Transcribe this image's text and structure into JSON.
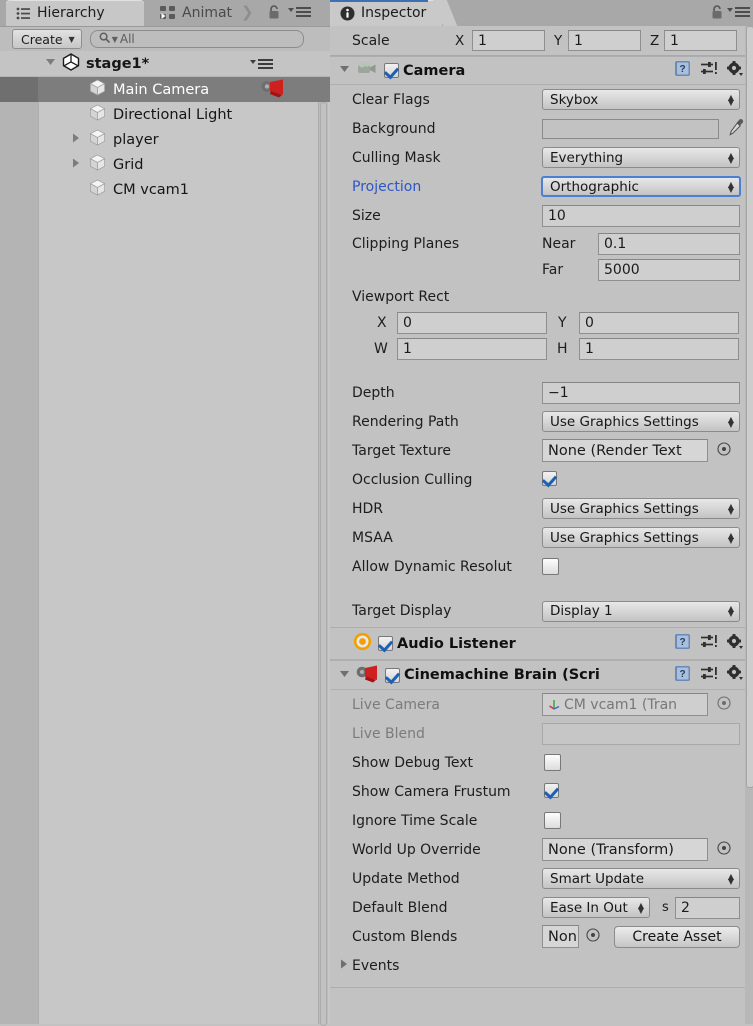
{
  "hierarchy": {
    "tabs": [
      {
        "label": "Hierarchy",
        "icon": "hierarchy-list-icon",
        "active": true
      },
      {
        "label": "Animat",
        "icon": "animator-nodes-icon",
        "active": false
      }
    ],
    "toolbar": {
      "create_label": "Create",
      "create_caret": "▼",
      "search_value": "",
      "search_placeholder": "All",
      "search_icon": "magnifier-icon"
    },
    "scene": {
      "name": "stage1*",
      "expanded": true,
      "icon": "unity-scene-icon"
    },
    "items": [
      {
        "label": "Main Camera",
        "icon": "gameobject-cube-icon",
        "selected": true,
        "expandable": false,
        "badge": "cinemachine-camera-icon"
      },
      {
        "label": "Directional Light",
        "icon": "gameobject-cube-icon",
        "selected": false,
        "expandable": false
      },
      {
        "label": "player",
        "icon": "gameobject-cube-icon",
        "selected": false,
        "expandable": true
      },
      {
        "label": "Grid",
        "icon": "gameobject-cube-icon",
        "selected": false,
        "expandable": true
      },
      {
        "label": "CM vcam1",
        "icon": "gameobject-cube-icon",
        "selected": false,
        "expandable": false
      }
    ]
  },
  "inspector": {
    "tab_label": "Inspector",
    "tab_icon": "info-circle-icon",
    "accent_color": "#3c6fb4",
    "transform_scale": {
      "label": "Scale",
      "axes": [
        {
          "axis": "X",
          "value": "1"
        },
        {
          "axis": "Y",
          "value": "1"
        },
        {
          "axis": "Z",
          "value": "1"
        }
      ]
    },
    "components": [
      {
        "name": "Camera",
        "icon": "camera-icon",
        "enabled": true,
        "expanded": true,
        "header_icons": [
          "help-book-icon",
          "preset-slider-icon",
          "gear-icon"
        ],
        "properties": [
          {
            "type": "popup",
            "label": "Clear Flags",
            "value": "Skybox"
          },
          {
            "type": "color",
            "label": "Background",
            "value": "#3b4a72",
            "eyedropper": "eyedropper-icon"
          },
          {
            "type": "popup",
            "label": "Culling Mask",
            "value": "Everything"
          },
          {
            "type": "popup",
            "label": "Projection",
            "value": "Orthographic",
            "link": true,
            "focused": true
          },
          {
            "type": "field",
            "label": "Size",
            "value": "10"
          },
          {
            "type": "pair",
            "label": "Clipping Planes",
            "sub1": "Near",
            "v1": "0.1",
            "sub2": "Far",
            "v2": "5000"
          },
          {
            "type": "rect",
            "label": "Viewport Rect",
            "x_label": "X",
            "x": "0",
            "y_label": "Y",
            "y": "0",
            "w_label": "W",
            "w": "1",
            "h_label": "H",
            "h": "1"
          },
          {
            "type": "field",
            "label": "Depth",
            "value": "−1"
          },
          {
            "type": "popup",
            "label": "Rendering Path",
            "value": "Use Graphics Settings"
          },
          {
            "type": "object",
            "label": "Target Texture",
            "value": "None (Render Text"
          },
          {
            "type": "check",
            "label": "Occlusion Culling",
            "value": true
          },
          {
            "type": "popup",
            "label": "HDR",
            "value": "Use Graphics Settings"
          },
          {
            "type": "popup",
            "label": "MSAA",
            "value": "Use Graphics Settings"
          },
          {
            "type": "check",
            "label": "Allow Dynamic Resolut",
            "value": false
          },
          {
            "type": "popup",
            "label": "Target Display",
            "value": "Display 1"
          }
        ]
      },
      {
        "name": "Audio Listener",
        "icon": "audio-listener-icon",
        "enabled": true,
        "expanded": false,
        "header_icons": [
          "help-book-icon",
          "preset-slider-icon",
          "gear-icon"
        ],
        "properties": []
      },
      {
        "name": "Cinemachine Brain (Scri",
        "icon": "cinemachine-brain-icon",
        "enabled": true,
        "expanded": true,
        "header_icons": [
          "help-book-icon",
          "preset-slider-icon",
          "gear-icon"
        ],
        "properties": [
          {
            "type": "object",
            "label": "Live Camera",
            "value": "CM vcam1 (Tran",
            "dim": true,
            "value_icon": "transform-axis-icon"
          },
          {
            "type": "field",
            "label": "Live Blend",
            "value": "",
            "dim": true
          },
          {
            "type": "check",
            "label": "Show Debug Text",
            "value": false
          },
          {
            "type": "check",
            "label": "Show Camera Frustum",
            "value": true
          },
          {
            "type": "check",
            "label": "Ignore Time Scale",
            "value": false
          },
          {
            "type": "object",
            "label": "World Up Override",
            "value": "None (Transform)"
          },
          {
            "type": "popup",
            "label": "Update Method",
            "value": "Smart Update"
          },
          {
            "type": "blend",
            "label": "Default Blend",
            "value": "Ease In Out",
            "unit": "s",
            "seconds": "2"
          },
          {
            "type": "custom",
            "label": "Custom Blends",
            "value": "Non",
            "button": "Create Asset"
          },
          {
            "type": "foldout",
            "label": "Events",
            "expanded": false
          }
        ]
      }
    ]
  }
}
